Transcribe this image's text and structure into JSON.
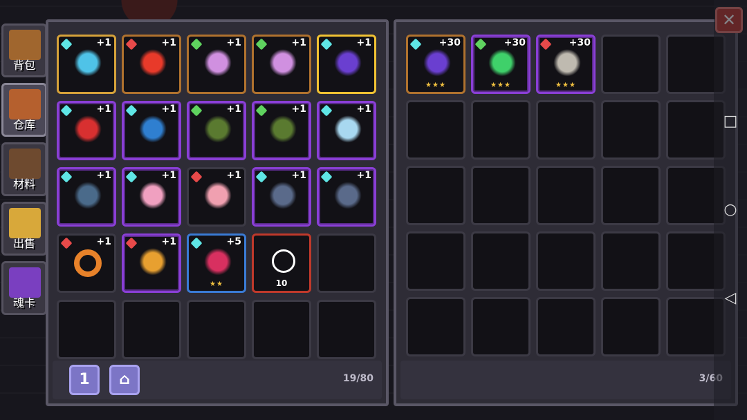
{
  "tabs": [
    {
      "label": "背包",
      "icon": "backpack-icon",
      "color": "#a0662e"
    },
    {
      "label": "仓库",
      "icon": "chest-icon",
      "color": "#b5602e",
      "active": true
    },
    {
      "label": "材料",
      "icon": "materials-icon",
      "color": "#6e4a2f"
    },
    {
      "label": "出售",
      "icon": "sell-icon",
      "color": "#d8a83a"
    },
    {
      "label": "魂卡",
      "icon": "soul-card-icon",
      "color": "#7a3fc0"
    }
  ],
  "left_panel": {
    "items": [
      {
        "name": "crystal-cluster",
        "level": "+1",
        "gem": "cyan",
        "frame": "gold",
        "color": "#4fc3e8"
      },
      {
        "name": "sun-orb",
        "level": "+1",
        "gem": "red",
        "frame": "orange",
        "color": "#e83a2a"
      },
      {
        "name": "scythe",
        "level": "+1",
        "gem": "green",
        "frame": "orange",
        "color": "#d090e0"
      },
      {
        "name": "scythe",
        "level": "+1",
        "gem": "green",
        "frame": "orange",
        "color": "#d090e0"
      },
      {
        "name": "staff",
        "level": "+1",
        "gem": "cyan",
        "frame": "yellow",
        "color": "#6a3fd0"
      },
      {
        "name": "fire-extinguisher",
        "level": "+1",
        "gem": "cyan",
        "frame": "purple",
        "color": "#d83030"
      },
      {
        "name": "rifle",
        "level": "+1",
        "gem": "cyan",
        "frame": "purple",
        "color": "#2f7fd0"
      },
      {
        "name": "launcher",
        "level": "+1",
        "gem": "green",
        "frame": "purple",
        "color": "#5a7a30"
      },
      {
        "name": "launcher",
        "level": "+1",
        "gem": "green",
        "frame": "purple",
        "color": "#5a7a30"
      },
      {
        "name": "ice-blade",
        "level": "+1",
        "gem": "cyan",
        "frame": "purple",
        "color": "#a8d8f0"
      },
      {
        "name": "trash-can",
        "level": "+1",
        "gem": "cyan",
        "frame": "purple",
        "color": "#4a6a8a"
      },
      {
        "name": "ice-cream",
        "level": "+1",
        "gem": "cyan",
        "frame": "purple",
        "color": "#f0a0c0"
      },
      {
        "name": "peach",
        "level": "+1",
        "gem": "red",
        "frame": "none",
        "color": "#f0a0b0"
      },
      {
        "name": "shield",
        "level": "+1",
        "gem": "cyan",
        "frame": "purple",
        "color": "#5a6a8a"
      },
      {
        "name": "shield",
        "level": "+1",
        "gem": "cyan",
        "frame": "purple",
        "color": "#5a6a8a"
      },
      {
        "name": "donut-ring",
        "level": "+1",
        "gem": "red",
        "frame": "none",
        "color": "#e8822a"
      },
      {
        "name": "slingshot",
        "level": "+1",
        "gem": "red",
        "frame": "purple",
        "color": "#e8a030"
      },
      {
        "name": "drill",
        "level": "+5",
        "gem": "cyan",
        "frame": "blue",
        "color": "#d83060",
        "stars": "★★"
      },
      {
        "name": "necklace",
        "count": "10",
        "frame": "red",
        "color": "#ffffff"
      },
      {
        "name": "empty",
        "frame": "none"
      },
      {
        "name": "empty",
        "frame": "none"
      },
      {
        "name": "empty",
        "frame": "none"
      },
      {
        "name": "empty",
        "frame": "none"
      },
      {
        "name": "empty",
        "frame": "none"
      },
      {
        "name": "empty",
        "frame": "none"
      }
    ],
    "btn1": "1",
    "btn2": "⌂",
    "count": "19/80"
  },
  "right_panel": {
    "items": [
      {
        "name": "staff",
        "level": "+30",
        "gem": "cyan",
        "frame": "orange",
        "color": "#6a3fd0",
        "stars": "★★★"
      },
      {
        "name": "green-eye",
        "level": "+30",
        "gem": "green",
        "frame": "purple",
        "color": "#3fd06a",
        "stars": "★★★"
      },
      {
        "name": "hook",
        "level": "+30",
        "gem": "red",
        "frame": "purple",
        "color": "#bfbab0",
        "stars": "★★★"
      }
    ],
    "empty_slots": 22,
    "count": "3/60"
  },
  "close_label": "✕"
}
